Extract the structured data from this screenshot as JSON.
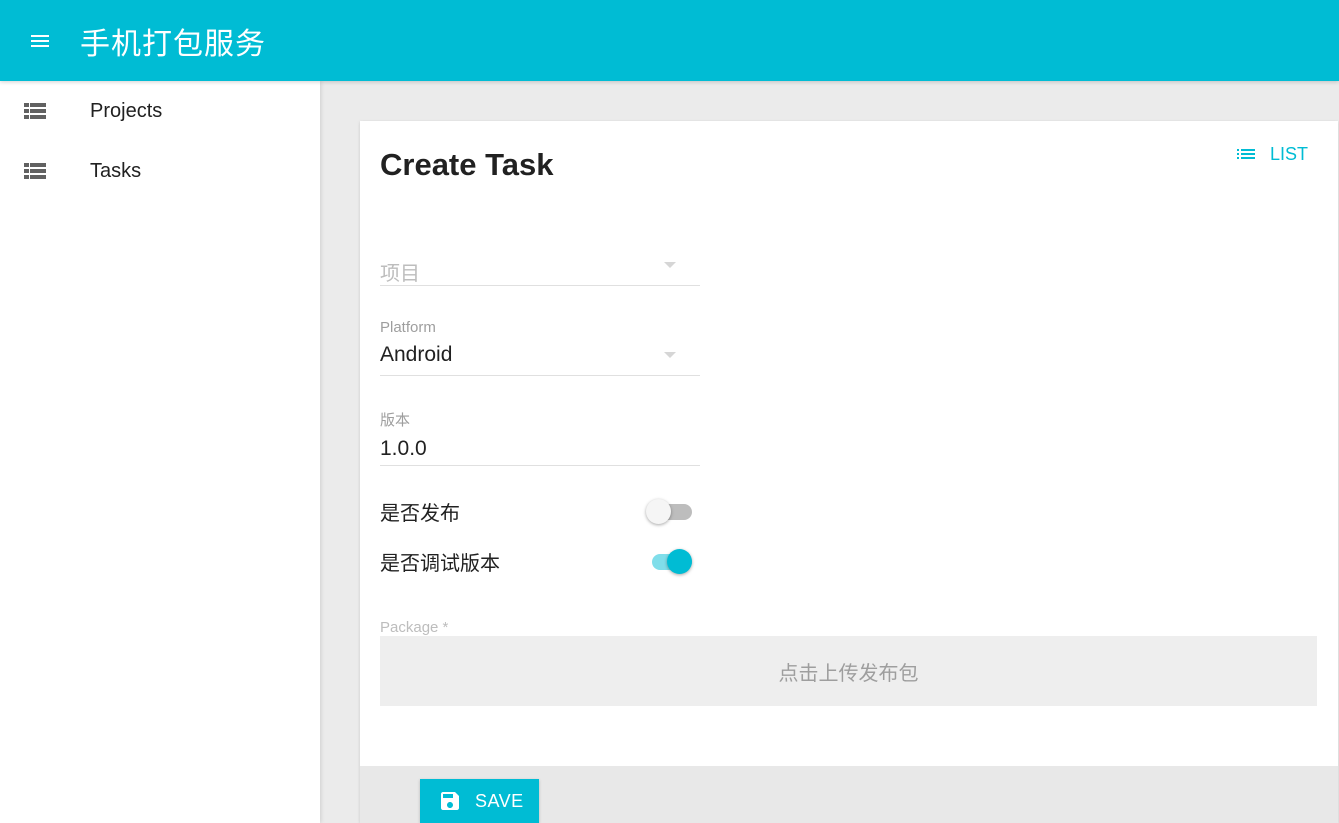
{
  "app": {
    "title": "手机打包服务",
    "accent_color": "#00bcd4"
  },
  "appbar": {
    "menu_icon": "menu-icon"
  },
  "sidebar": {
    "items": [
      {
        "label": "Projects",
        "icon": "view-list-icon"
      },
      {
        "label": "Tasks",
        "icon": "view-list-icon"
      }
    ]
  },
  "page": {
    "title": "Create Task",
    "list_button": {
      "label": "LIST",
      "icon": "list-icon"
    }
  },
  "form": {
    "project": {
      "placeholder": "项目",
      "value": ""
    },
    "platform": {
      "label": "Platform",
      "value": "Android"
    },
    "version": {
      "label": "版本",
      "value": "1.0.0"
    },
    "publish": {
      "label": "是否发布",
      "checked": false
    },
    "debug": {
      "label": "是否调试版本",
      "checked": true
    },
    "package": {
      "label": "Package *",
      "dropzone_text": "点击上传发布包"
    }
  },
  "toolbar": {
    "save_label": "SAVE",
    "save_icon": "save-icon"
  }
}
